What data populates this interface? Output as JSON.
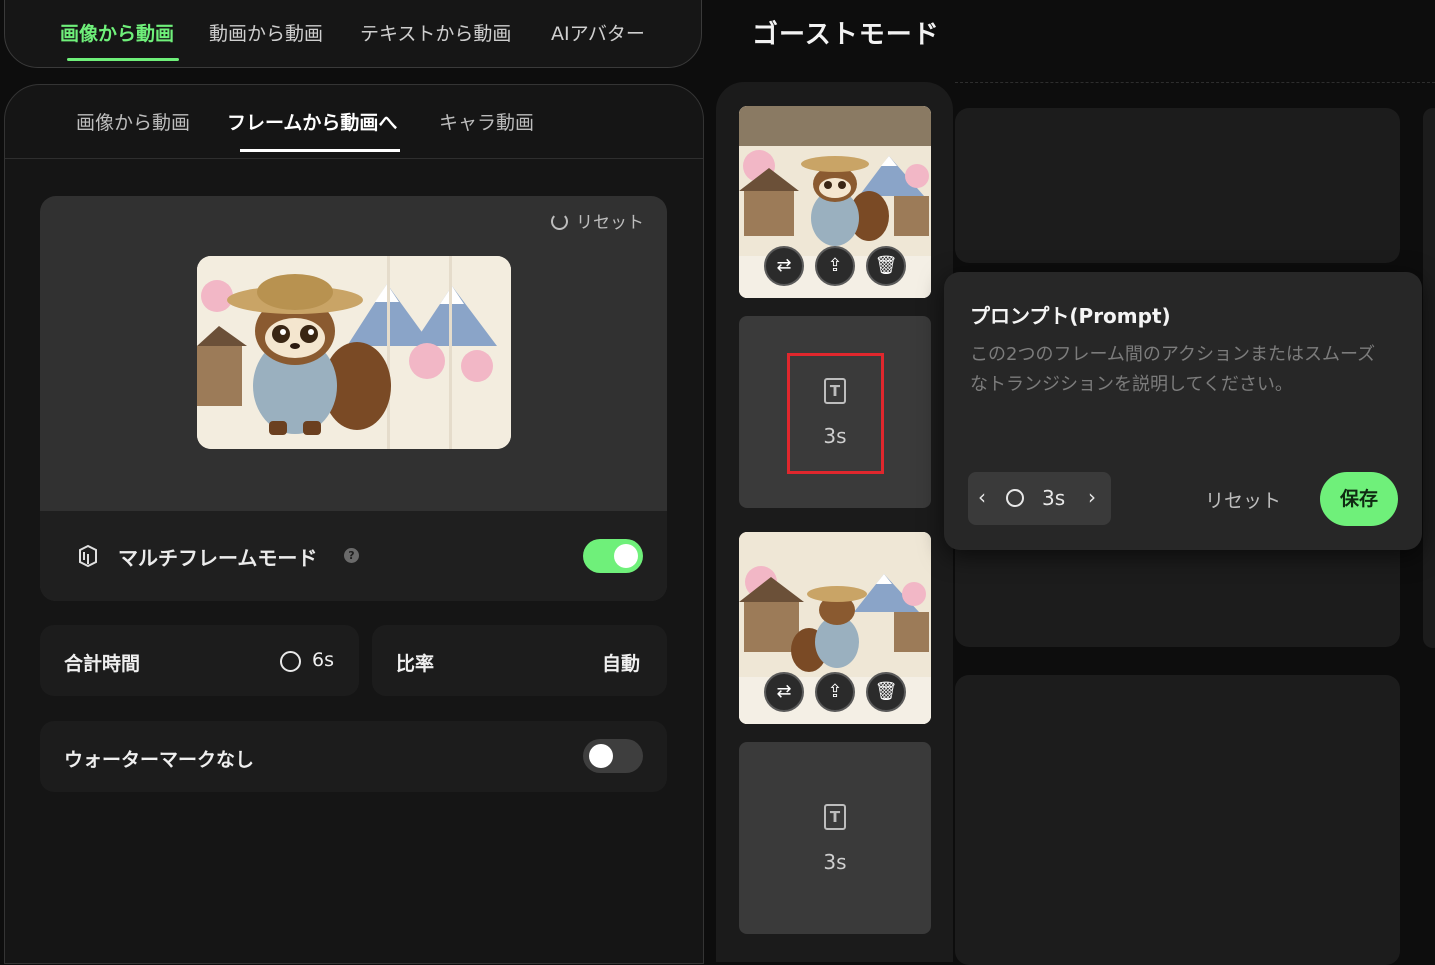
{
  "top_nav": {
    "tabs": [
      "画像から動画",
      "動画から動画",
      "テキストから動画",
      "AIアバター"
    ],
    "active_index": 0
  },
  "page_title": "ゴーストモード",
  "sub_tabs": {
    "tabs": [
      "画像から動画",
      "フレームから動画へ",
      "キャラ動画"
    ],
    "active_index": 1
  },
  "preview": {
    "reset_label": "リセット",
    "multi_frame_label": "マルチフレームモード",
    "multi_frame_on": true
  },
  "settings": {
    "total_time_label": "合計時間",
    "total_time_value": "6s",
    "ratio_label": "比率",
    "ratio_value": "自動",
    "watermark_label": "ウォーターマークなし",
    "watermark_on": false
  },
  "frames": [
    {
      "kind": "image",
      "actions": [
        "replace-icon",
        "upload-icon",
        "trash-icon"
      ]
    },
    {
      "kind": "transition",
      "icon": "T",
      "duration": "3s"
    },
    {
      "kind": "image",
      "actions": [
        "replace-icon",
        "upload-icon",
        "trash-icon"
      ]
    },
    {
      "kind": "transition",
      "icon": "T",
      "duration": "3s"
    }
  ],
  "prompt_panel": {
    "title": "プロンプト(Prompt)",
    "placeholder": "この2つのフレーム間のアクションまたはスムーズなトランジションを説明してください。",
    "duration": "3s",
    "reset_label": "リセット",
    "save_label": "保存"
  },
  "colors": {
    "accent": "#6ff07a",
    "highlight_box": "#e0272d",
    "background": "#0d0d0d"
  }
}
